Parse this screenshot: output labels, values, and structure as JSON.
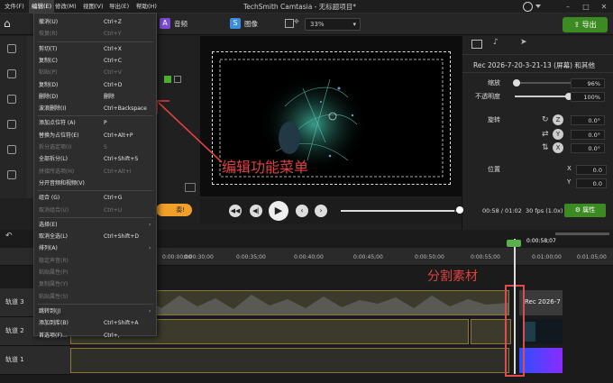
{
  "app": {
    "title": "TechSmith Camtasia - 无标题项目*"
  },
  "menubar": [
    "文件(F)",
    "编辑(E)",
    "修改(M)",
    "视图(V)",
    "导出(E)",
    "帮助(H)"
  ],
  "toolbar": {
    "tab_audio": "音频",
    "tab_image": "图像",
    "zoom": "33%",
    "export": "导出"
  },
  "edit_menu": [
    {
      "label": "撤消(U)",
      "shortcut": "Ctrl+Z",
      "enabled": true
    },
    {
      "label": "恢复(R)",
      "shortcut": "Ctrl+Y",
      "enabled": false
    },
    {
      "sep": true
    },
    {
      "label": "剪切(T)",
      "shortcut": "Ctrl+X",
      "enabled": true
    },
    {
      "label": "复制(C)",
      "shortcut": "Ctrl+C",
      "enabled": true
    },
    {
      "label": "粘贴(P)",
      "shortcut": "Ctrl+V",
      "enabled": false
    },
    {
      "label": "复制(D)",
      "shortcut": "Ctrl+D",
      "enabled": true
    },
    {
      "label": "删除(D)",
      "shortcut": "删除",
      "enabled": true
    },
    {
      "label": "波浪删除(I)",
      "shortcut": "Ctrl+Backspace",
      "enabled": true
    },
    {
      "sep": true
    },
    {
      "label": "添加点位符 (A)",
      "shortcut": "P",
      "enabled": true
    },
    {
      "label": "替换为占位符(E)",
      "shortcut": "Ctrl+Alt+P",
      "enabled": true
    },
    {
      "label": "拆分选定项(I)",
      "shortcut": "S",
      "enabled": false
    },
    {
      "label": "全部拆分(L)",
      "shortcut": "Ctrl+Shift+S",
      "enabled": true
    },
    {
      "label": "拼接所选项(H)",
      "shortcut": "Ctrl+Alt+I",
      "enabled": false
    },
    {
      "label": "分开音频和视频(V)",
      "shortcut": "",
      "enabled": true
    },
    {
      "sep": true
    },
    {
      "label": "组合 (G)",
      "shortcut": "Ctrl+G",
      "enabled": true
    },
    {
      "label": "取消组合(U)",
      "shortcut": "Ctrl+U",
      "enabled": false
    },
    {
      "sep": true
    },
    {
      "label": "选择(E)",
      "shortcut": "",
      "enabled": true,
      "submenu": true
    },
    {
      "label": "取消全选(L)",
      "shortcut": "Ctrl+Shift+D",
      "enabled": true
    },
    {
      "label": "排列(A)",
      "shortcut": "",
      "enabled": true,
      "submenu": true
    },
    {
      "label": "稳定声音(R)",
      "shortcut": "",
      "enabled": false
    },
    {
      "label": "粘贴属性(P)",
      "shortcut": "",
      "enabled": false
    },
    {
      "label": "复制属性(Y)",
      "shortcut": "",
      "enabled": false
    },
    {
      "label": "粘贴属性(S)",
      "shortcut": "",
      "enabled": false
    },
    {
      "sep": true
    },
    {
      "label": "跳转到(J)",
      "shortcut": "",
      "enabled": true,
      "submenu": true
    },
    {
      "label": "添加到库(B)",
      "shortcut": "Ctrl+Shift+A",
      "enabled": true
    },
    {
      "label": "首选项(F)...",
      "shortcut": "Ctrl+,",
      "enabled": true
    }
  ],
  "annotations": {
    "edit_menu": "编辑功能菜单",
    "split": "分割素材"
  },
  "right_panel": {
    "clip_title": "Rec 2026-7-20-3-21-13 (屏幕) 和其他",
    "scale_label": "缩放",
    "scale_value": "96%",
    "opacity_label": "不透明度",
    "opacity_value": "100%",
    "rotate_label": "旋转",
    "rot_z": "0.0°",
    "rot_y": "0.0°",
    "rot_x": "0.0°",
    "axis_z": "Z",
    "axis_y": "Y",
    "axis_x": "X",
    "position_label": "位置",
    "pos_x": "0.0",
    "pos_y": "0.0",
    "pos_axis_x": "X",
    "pos_axis_y": "Y"
  },
  "playback": {
    "time": "00:58 / 01:02",
    "fps": "30 fps (1.0x)",
    "properties": "属性"
  },
  "timeline": {
    "playhead_time": "0:00:58;07",
    "ruler": [
      "0:00:00;00",
      "0:00:30;00",
      "0:00:35;00",
      "0:00:40;00",
      "0:00:45;00",
      "0:00:50;00",
      "0:00:55;00",
      "0:01:00;00",
      "0:01:05;00"
    ],
    "tracks": [
      "轨道 3",
      "轨道 2",
      "轨道 1"
    ],
    "clip_label": "Rec 2026-7"
  },
  "colors": {
    "accent_green": "#3c8a22",
    "annotation_red": "#e24040"
  }
}
